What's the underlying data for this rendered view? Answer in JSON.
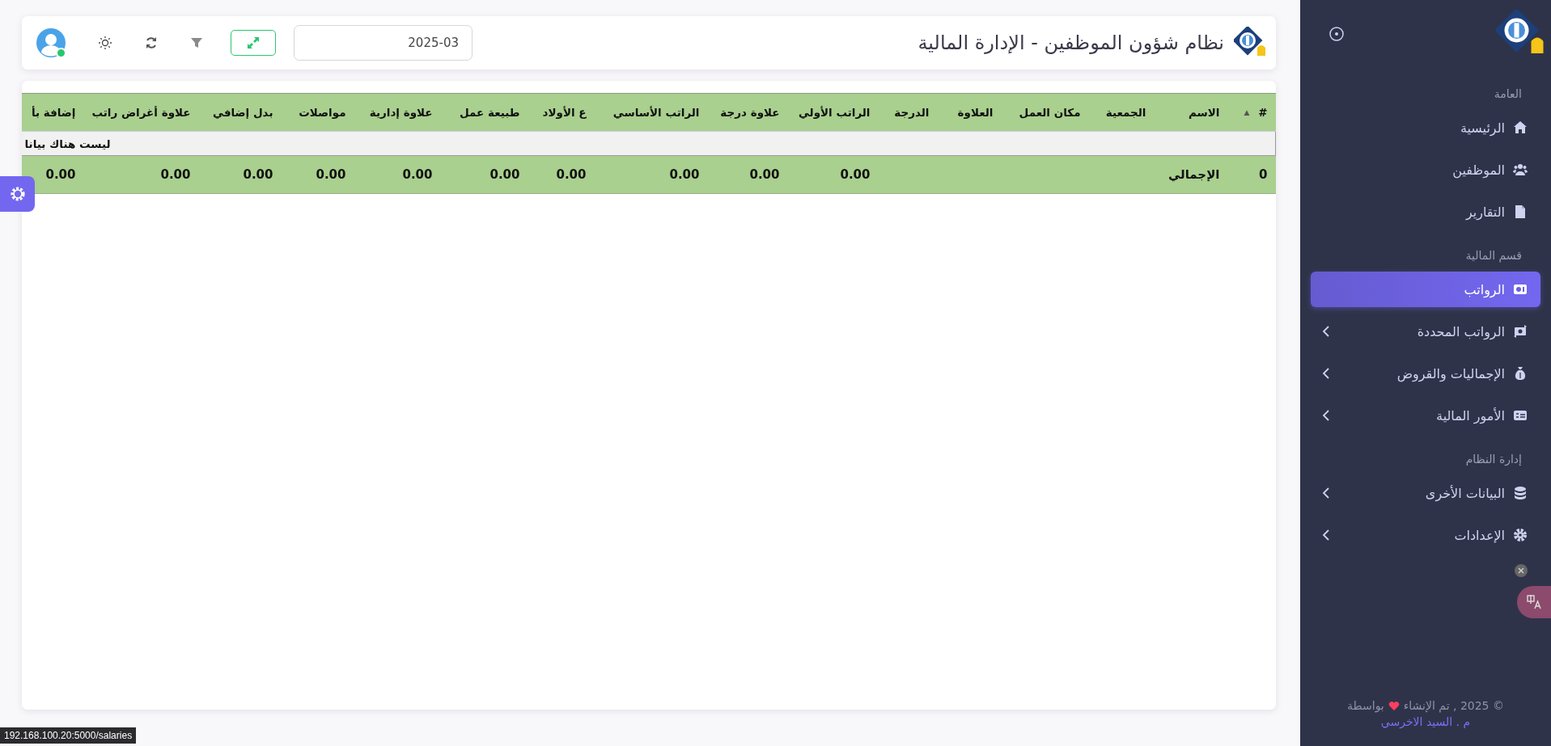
{
  "header": {
    "title": "نظام شؤون الموظفين - الإدارة المالية",
    "date": "2025-03",
    "user_online": true
  },
  "table": {
    "columns": [
      "#",
      "الاسم",
      "الجمعية",
      "مكان العمل",
      "العلاوة",
      "الدرجة",
      "الراتب الأولي",
      "علاوة درجة",
      "الراتب الأساسي",
      "ع الأولاد",
      "طبيعة عمل",
      "علاوة إدارية",
      "مواصلات",
      "بدل إضافي",
      "علاوة أغراض راتب",
      "إضافة بأ"
    ],
    "sort_indicator": "▲",
    "empty_message": "ليست هناك بيانا",
    "totals": {
      "number": "0",
      "label": "الإجمالي",
      "amounts": [
        "0.00",
        "0.00",
        "0.00",
        "0.00",
        "0.00",
        "0.00",
        "0.00",
        "0.00",
        "0.00",
        "0.00"
      ]
    }
  },
  "sidebar": {
    "sections": [
      {
        "title": "العامة",
        "items": [
          {
            "label": "الرئيسية",
            "selected": false,
            "expandable": false
          },
          {
            "label": "الموظفين",
            "selected": false,
            "expandable": false
          },
          {
            "label": "التقارير",
            "selected": false,
            "expandable": false
          }
        ]
      },
      {
        "title": "قسم المالية",
        "items": [
          {
            "label": "الرواتب",
            "selected": true,
            "expandable": false
          },
          {
            "label": "الرواتب المحددة",
            "selected": false,
            "expandable": true
          },
          {
            "label": "الإجماليات والقروض",
            "selected": false,
            "expandable": true
          },
          {
            "label": "الأمور المالية",
            "selected": false,
            "expandable": true
          }
        ]
      },
      {
        "title": "إدارة النظام",
        "items": [
          {
            "label": "البيانات الأخرى",
            "selected": false,
            "expandable": true
          },
          {
            "label": "الإعدادات",
            "selected": false,
            "expandable": true
          }
        ]
      }
    ],
    "footer": {
      "text_before": "© 2025 , تم الإنشاء",
      "text_after": "بواسطة",
      "author_link": "م . السيد الاخرسي"
    }
  },
  "status_bar": {
    "url": "192.168.100.20:5000/salaries"
  }
}
